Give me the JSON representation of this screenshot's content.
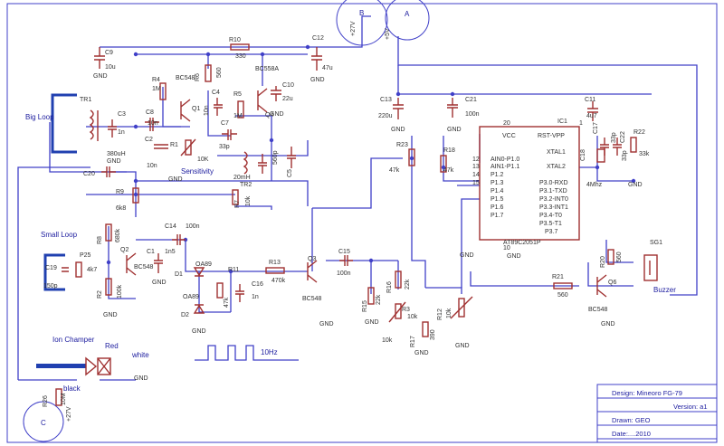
{
  "circles": {
    "a": "A",
    "b": "B",
    "c": "C"
  },
  "supply": {
    "v27": "+27V",
    "v5": "+5V",
    "v27b": "+27V"
  },
  "labels": {
    "big_loop": "Big Loop",
    "small_loop": "Small Loop",
    "ion_chamber": "Ion Champer",
    "red": "Red",
    "white": "white",
    "black": "black",
    "sensitivity": "Sensitivity",
    "buzzer": "Buzzer",
    "freq": "10Hz"
  },
  "components": {
    "c9": "C9",
    "c9v": "10u",
    "r10": "R10",
    "r10v": "330",
    "c12": "C12",
    "c12v": "47u",
    "r4": "R4",
    "r4v": "1M",
    "q1n": "BC548",
    "q1": "Q1",
    "r6": "R6",
    "r6v": "560",
    "q4n": "BC558A",
    "q4": "Q4",
    "c4": "C4",
    "c4v": "10n",
    "r5": "R5",
    "r5v": "1M",
    "c10": "C10",
    "c10v": "22u",
    "tr1": "TR1",
    "c3": "C3",
    "c3v": "1n",
    "l1v": "380uH",
    "c8": "C8",
    "c8v": "10n",
    "c2": "C2",
    "c2v": "10n",
    "r1": "R1",
    "r1v": "10K",
    "c7": "C7",
    "c7v": "33p",
    "c6v": "560p",
    "c5": "C5",
    "c5v": "C5",
    "tr2": "TR2",
    "l2v": "20mH",
    "c20": "C20",
    "r9": "R9",
    "r9v": "6k8",
    "r7": "R7",
    "r7v": "10k",
    "r8": "R8",
    "r8v": "680k",
    "q2": "Q2",
    "q2n": "BC548",
    "r2": "R2",
    "r2v": "100k",
    "c14": "C14",
    "c14v": "100n",
    "c1": "C1",
    "c1v": "1n5",
    "c1b": "10n",
    "d1": "D1",
    "d1n": "OA89",
    "d2": "D2",
    "d2n": "OA89",
    "r11": "R11",
    "r11v": "47k",
    "c16": "C16",
    "c16v": "1n",
    "r13": "R13",
    "r13v": "470k",
    "q3": "Q3",
    "q3n": "BC548",
    "c15": "C15",
    "c15v": "100n",
    "p25": "P25",
    "p25v": "4k7",
    "c19": "C19",
    "c19v": "150p",
    "r26": "R26",
    "r26v": "10M",
    "c13": "C13",
    "c13v": "220u",
    "c21": "C21",
    "c21v": "100n",
    "r23": "R23",
    "r23v": "47k",
    "r18": "R18",
    "r18v": "47k",
    "c11": "C11",
    "c11v": "4u7",
    "ic1": "IC1",
    "c17": "C17",
    "c17v": "33p",
    "c22": "C22",
    "c22v": "33p",
    "r22": "R22",
    "r22v": "33k",
    "c18": "C18",
    "xtal": "4Mhz",
    "mcu": "AT89C2051P",
    "r15": "R15",
    "r15v": "22k",
    "r16": "R16",
    "r16v": "22k",
    "r3": "R3",
    "r3v": "10k",
    "r17": "R17",
    "r17v": "390",
    "r12": "R12",
    "r12v": "10k",
    "r21": "R21",
    "r21v": "560",
    "q6": "Q6",
    "q6n": "BC548",
    "r20": "R20",
    "r20v": "560",
    "sg1": "SG1",
    "gnd": "GND"
  },
  "ic_pins": {
    "vcc": "VCC",
    "rst": "RST-VPP",
    "xtal1": "XTAL1",
    "xtal2": "XTAL2",
    "p10": "AIN0-P1.0",
    "p11": "AIN1-P1.1",
    "p12": "P1.2",
    "p13": "P1.3",
    "p14": "P1.4",
    "p15": "P1.5",
    "p16": "P1.6",
    "p17": "P1.7",
    "p30": "P3.0-RXD",
    "p31": "P3.1-TXD",
    "p32": "P3.2-INT0",
    "p33": "P3.3-INT1",
    "p34": "P3.4-T0",
    "p35": "P3.5-T1",
    "p37": "P3.7",
    "n20": "20",
    "n1": "1",
    "n12": "12",
    "n13": "13",
    "n14": "14",
    "n15": "15",
    "n10": "10",
    "n4": "4",
    "n5": "5"
  },
  "titleblock": {
    "design": "Design: Mineoro FG-79",
    "version": "Version:  a1",
    "drawn": "Drawn:  GEO",
    "date": "Date:....2010"
  }
}
